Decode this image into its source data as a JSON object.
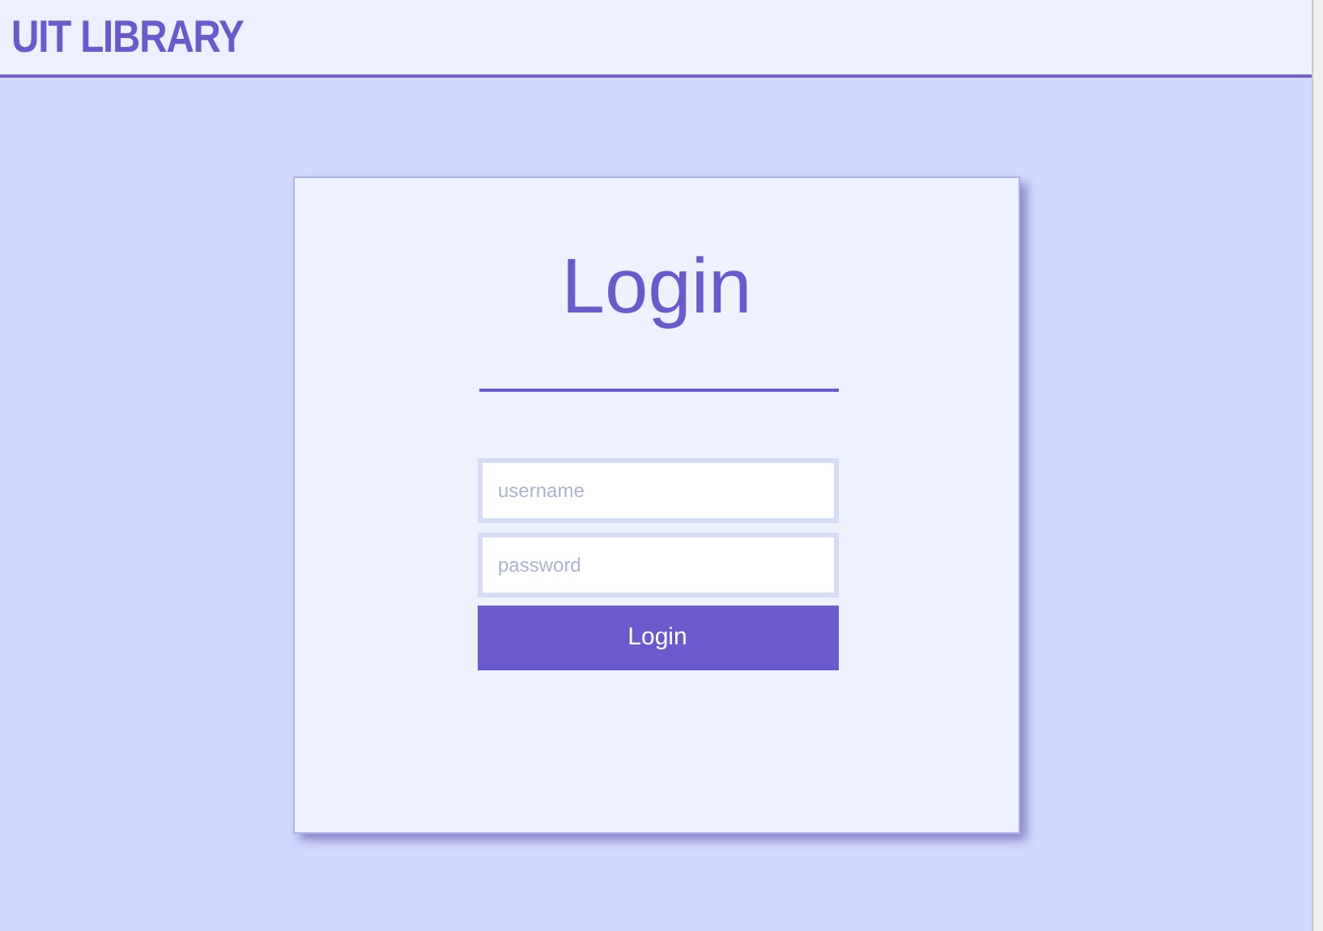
{
  "header": {
    "title": "UIT LIBRARY"
  },
  "login_card": {
    "title": "Login",
    "fields": [
      {
        "placeholder": "username"
      },
      {
        "placeholder": "password"
      }
    ],
    "button": "Login"
  }
}
